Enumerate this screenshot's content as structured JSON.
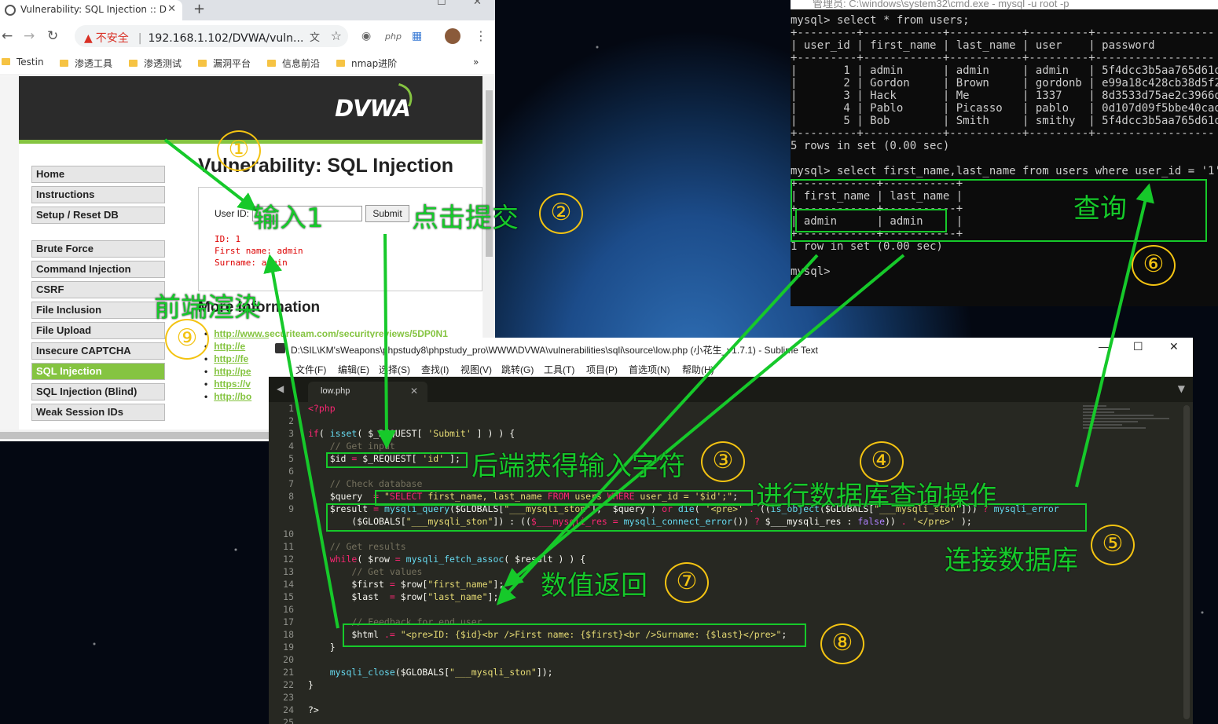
{
  "browser": {
    "tab_title": "Vulnerability: SQL Injection :: D",
    "new_tab": "+",
    "url_warning": "不安全",
    "url": "192.168.1.102/DVWA/vuln...",
    "bookmarks": [
      "Testin",
      "渗透工具",
      "渗透测试",
      "漏洞平台",
      "信息前沿",
      "nmap进阶"
    ],
    "bookmarks_more": "»",
    "logo": "DVWA",
    "menu": [
      "Home",
      "Instructions",
      "Setup / Reset DB",
      "Brute Force",
      "Command Injection",
      "CSRF",
      "File Inclusion",
      "File Upload",
      "Insecure CAPTCHA",
      "SQL Injection",
      "SQL Injection (Blind)",
      "Weak Session IDs"
    ],
    "page_title": "Vulnerability: SQL Injection",
    "user_id_label": "User ID:",
    "submit_label": "Submit",
    "result_text": "ID: 1\nFirst name: admin\nSurname: admin",
    "more_info": "More Information",
    "links": [
      "http://www.securiteam.com/securityreviews/5DP0N1",
      "http://e",
      "http://fe",
      "http://pe",
      "https://v",
      "http://bo"
    ]
  },
  "cmd": {
    "title": "管理员: C:\\windows\\system32\\cmd.exe - mysql  -u root -p",
    "text": "mysql> select * from users;\n+---------+------------+-----------+---------+------------------\n| user_id | first_name | last_name | user    | password\n+---------+------------+-----------+---------+------------------\n|       1 | admin      | admin     | admin   | 5f4dcc3b5aa765d61d832\n|       2 | Gordon     | Brown     | gordonb | e99a18c428cb38d5f2608\n|       3 | Hack       | Me        | 1337    | 8d3533d75ae2c3966d7e0\n|       4 | Pablo      | Picasso   | pablo   | 0d107d09f5bbe40cade3d\n|       5 | Bob        | Smith     | smithy  | 5f4dcc3b5aa765d61d832\n+---------+------------+-----------+---------+------------------\n5 rows in set (0.00 sec)\n\nmysql> select first_name,last_name from users where user_id = '1';\n+------------+-----------+\n| first_name | last_name |\n+------------+-----------+\n| admin      | admin     |\n+------------+-----------+\n1 row in set (0.00 sec)\n\nmysql>"
  },
  "sublime": {
    "title": "D:\\SIL\\KM'sWeapons\\phpstudy8\\phpstudy_pro\\WWW\\DVWA\\vulnerabilities\\sqli\\source\\low.php (小花生_v1.7.1) - Sublime Text",
    "menu": [
      "文件(F)",
      "编辑(E)",
      "选择(S)",
      "查找(I)",
      "视图(V)",
      "跳转(G)",
      "工具(T)",
      "项目(P)",
      "首选项(N)",
      "帮助(H)"
    ],
    "tab": "low.php",
    "line_numbers": "1\n2\n3\n4\n5\n6\n7\n8\n9\n\n10\n11\n12\n13\n14\n15\n16\n17\n18\n19\n20\n21\n22\n23\n24\n25"
  },
  "annotations": {
    "a1": "输入1",
    "a2": "点击提交",
    "a3": "后端获得输入字符",
    "a4": "进行数据库查询操作",
    "a5": "连接数据库",
    "a6": "查询",
    "a7": "数值返回",
    "a9": "前端渲染",
    "n1": "①",
    "n2": "②",
    "n3": "③",
    "n4": "④",
    "n5": "⑤",
    "n6": "⑥",
    "n7": "⑦",
    "n8": "⑧",
    "n9": "⑨"
  }
}
